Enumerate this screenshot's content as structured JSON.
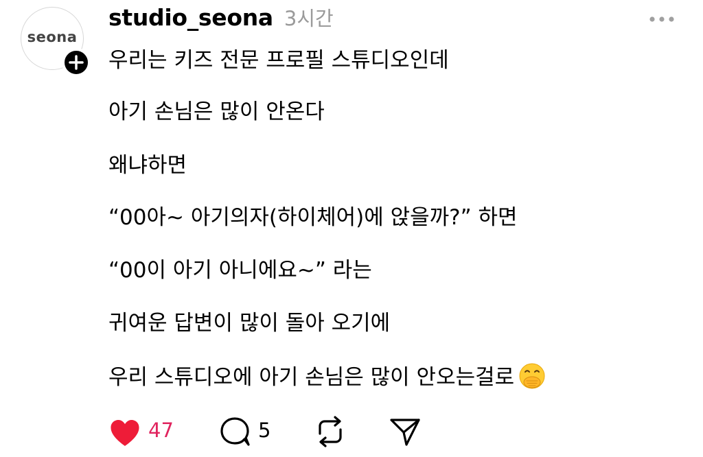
{
  "post": {
    "avatar_text": "seona",
    "username": "studio_seona",
    "time": "3시간",
    "lines": [
      "우리는 키즈 전문 프로필 스튜디오인데",
      "아기 손님은 많이 안온다",
      "왜냐하면",
      "“00아~ 아기의자(하이체어)에 앉을까?” 하면",
      "“00이 아기 아니에요~” 라는",
      "귀여운 답변이 많이 돌아 오기에",
      "우리 스튜디오에 아기 손님은 많이 안오는걸로"
    ],
    "emoji": "face-with-hand-over-mouth"
  },
  "actions": {
    "like_count": "47",
    "reply_count": "5"
  },
  "colors": {
    "like": "#ee1c38",
    "like_count": "#e0245e",
    "time": "#9a9a9a",
    "icon": "#000000"
  }
}
